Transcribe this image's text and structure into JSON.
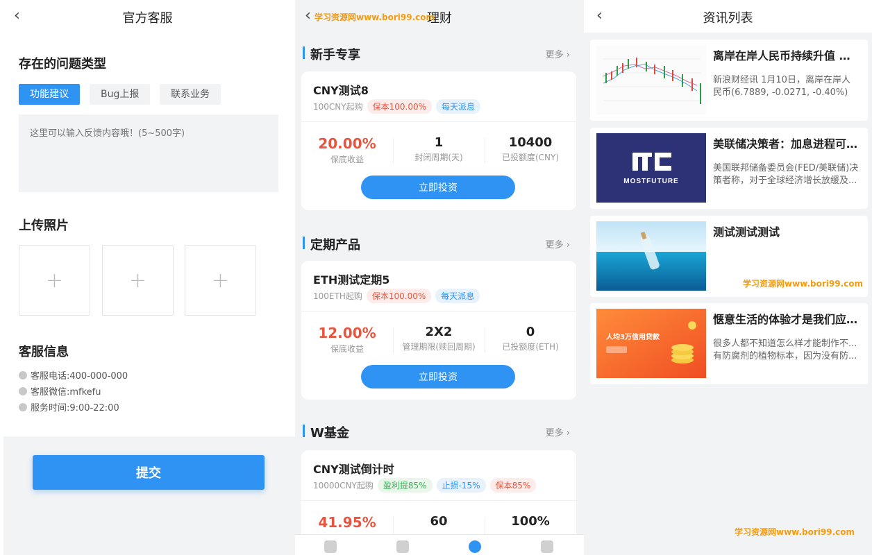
{
  "feedback": {
    "back_icon": "chevron-left-icon",
    "title": "官方客服",
    "issue_type_title": "存在的问题类型",
    "issue_types": [
      "功能建议",
      "Bug上报",
      "联系业务"
    ],
    "selected_issue_type": "功能建议",
    "textarea_placeholder": "这里可以输入反馈内容哦！(5~500字)",
    "upload_title": "上传照片",
    "upload_plus": [
      "+",
      "+",
      "+"
    ],
    "service_title": "客服信息",
    "service_phone": "客服电话:400-000-000",
    "service_wechat": "客服微信:mfkefu",
    "service_hours": "服务时间:9:00-22:00",
    "submit_label": "提交"
  },
  "finance": {
    "title": "理财",
    "watermark": "学习资源网www.bori99.com",
    "more_label": "更多",
    "groups": [
      {
        "name": "新手专享",
        "product": {
          "name": "CNY测试8",
          "min_buy": "100CNY起购",
          "tags": [
            "保本100.00%",
            "每天派息"
          ],
          "stats": [
            {
              "value": "20.00%",
              "label": "保底收益"
            },
            {
              "value": "1",
              "label": "封闭周期(天)"
            },
            {
              "value": "10400",
              "label": "已投额度(CNY)"
            }
          ],
          "button": "立即投资"
        }
      },
      {
        "name": "定期产品",
        "product": {
          "name": "ETH测试定期5",
          "min_buy": "100ETH起购",
          "tags": [
            "保本100.00%",
            "每天派息"
          ],
          "stats": [
            {
              "value": "12.00%",
              "label": "保底收益"
            },
            {
              "value": "2X2",
              "label": "管理期限(赎回周期)"
            },
            {
              "value": "0",
              "label": "已投额度(ETH)"
            }
          ],
          "button": "立即投资"
        }
      },
      {
        "name": "W基金",
        "product": {
          "name": "CNY测试倒计时",
          "min_buy": "10000CNY起购",
          "tags": [
            "盈利提85%",
            "止损-15%",
            "保本85%"
          ],
          "stats": [
            {
              "value": "41.95%",
              "label": ""
            },
            {
              "value": "60",
              "label": ""
            },
            {
              "value": "100%",
              "label": ""
            }
          ]
        }
      }
    ]
  },
  "news": {
    "title": "资讯列表",
    "items": [
      {
        "title": "离岸在岸人民币持续升值 双...",
        "desc": "新浪财经讯 1月10日，离岸在岸人民币(6.7889, -0.0271, -0.40%)持..."
      },
      {
        "title": "美联储决策者：加息进程可...",
        "desc": "美国联邦储备委员会(FED/美联储)决策者称，对于全球经济增长放缓及...",
        "logo_text": "MOSTFUTURE"
      },
      {
        "title": "测试测试测试",
        "desc": ""
      },
      {
        "title": "惬意生活的体验才是我们应...",
        "desc": "很多人都不知道怎么样才能制作不...有防腐剂的植物标本，因为没有防...",
        "banner_text": "人均3万信用贷款"
      }
    ],
    "watermark": "学习资源网www.bori99.com"
  }
}
